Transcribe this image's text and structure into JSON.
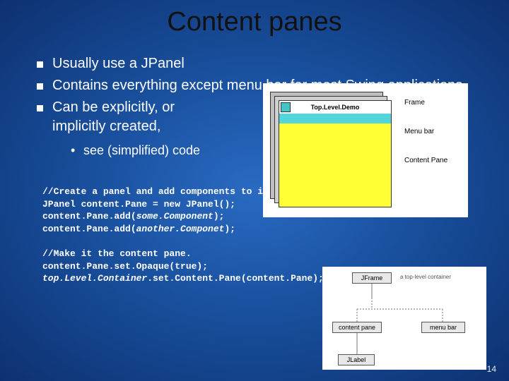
{
  "title": "Content panes",
  "bullets": [
    "Usually use a JPanel",
    "Contains everything except menu bar for most Swing applications",
    "Can be explicitly, or\nimplicitly created,"
  ],
  "subbullets": [
    "see (simplified) code"
  ],
  "code": {
    "c1": "//Create a panel and add components to it.",
    "c2": "JPanel content.Pane = new JPanel();",
    "c3": "content.Pane.add(",
    "c3i": "some.Component",
    "c3b": ");",
    "c4": "content.Pane.add(",
    "c4i": "another.Componet",
    "c4b": ");",
    "blank": "",
    "c5": "//Make it the content pane.",
    "c6": "content.Pane.set.Opaque(true);",
    "c7a": "top.Level.Container",
    "c7b": ".set.Content.Pane(content.Pane);"
  },
  "fig1": {
    "window_title": "Top.Level.Demo",
    "labels": {
      "frame": "Frame",
      "menubar": "Menu bar",
      "contentpane": "Content Pane"
    }
  },
  "fig2": {
    "jframe": "JFrame",
    "note": "a top-level container",
    "contentpane": "content pane",
    "menubar": "menu bar",
    "jlabel": "JLabel"
  },
  "page_number": "14"
}
